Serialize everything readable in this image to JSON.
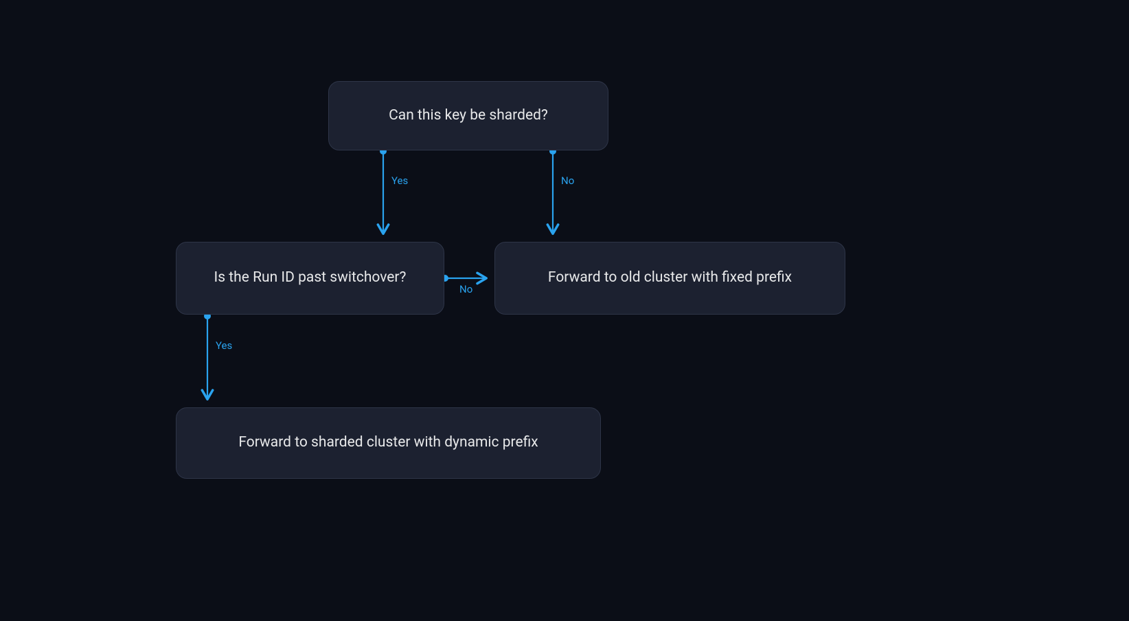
{
  "nodes": {
    "q_sharded": {
      "text": "Can this key be sharded?"
    },
    "q_runid": {
      "text": "Is the Run ID past switchover?"
    },
    "a_old": {
      "text": "Forward to old cluster with fixed prefix"
    },
    "a_sharded": {
      "text": "Forward to sharded cluster with dynamic prefix"
    }
  },
  "edges": {
    "sharded_yes": {
      "label": "Yes"
    },
    "sharded_no": {
      "label": "No"
    },
    "runid_yes": {
      "label": "Yes"
    },
    "runid_no": {
      "label": "No"
    }
  },
  "colors": {
    "bg": "#0b0e17",
    "node_bg": "#1c2130",
    "node_border": "#2e3548",
    "text": "#e8e9ea",
    "arrow": "#2aa3ef"
  }
}
